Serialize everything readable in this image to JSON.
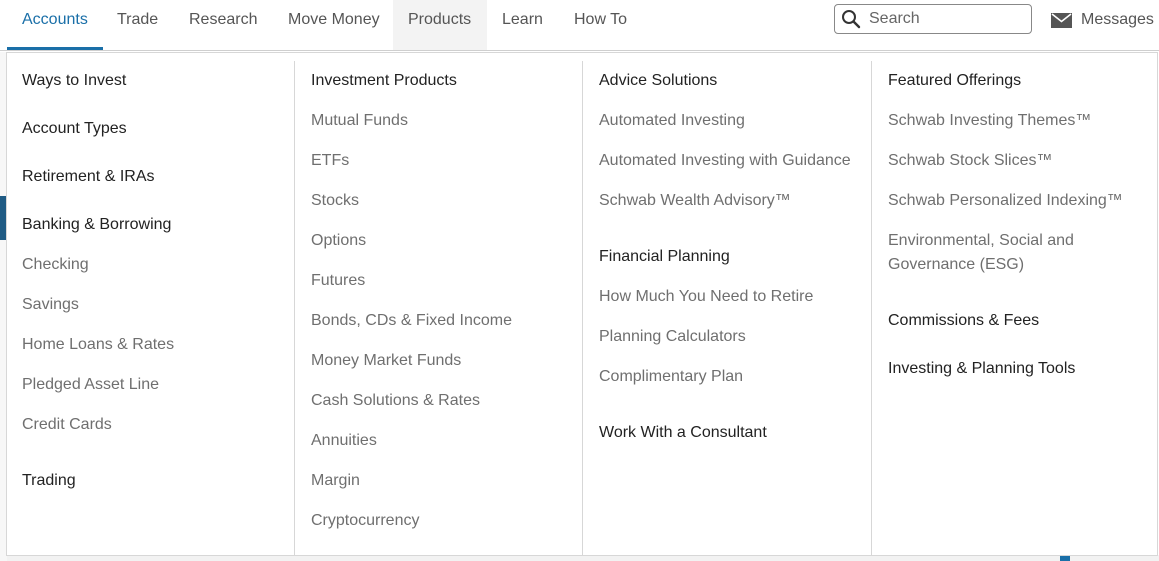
{
  "topnav": {
    "items": [
      "Accounts",
      "Trade",
      "Research",
      "Move Money",
      "Products",
      "Learn",
      "How To"
    ],
    "active": "Accounts",
    "hovered": "Products",
    "search_placeholder": "Search",
    "messages_label": "Messages"
  },
  "menu": {
    "col1": {
      "ways": "Ways to Invest",
      "account_types": "Account Types",
      "retirement": "Retirement & IRAs",
      "banking": "Banking & Borrowing",
      "checking": "Checking",
      "savings": "Savings",
      "home_loans": "Home Loans & Rates",
      "pledged": "Pledged Asset Line",
      "credit_cards": "Credit Cards",
      "trading": "Trading"
    },
    "col2": {
      "head": "Investment Products",
      "items": [
        "Mutual Funds",
        "ETFs",
        "Stocks",
        "Options",
        "Futures",
        "Bonds, CDs & Fixed Income",
        "Money Market Funds",
        "Cash Solutions & Rates",
        "Annuities",
        "Margin",
        "Cryptocurrency"
      ]
    },
    "col3": {
      "advice": "Advice Solutions",
      "automated": "Automated Investing",
      "automated_guidance": "Automated Investing with Guidance",
      "wealth": "Schwab Wealth Advisory™",
      "planning": "Financial Planning",
      "how_much": "How Much You Need to Retire",
      "calculators": "Planning Calculators",
      "complimentary": "Complimentary Plan",
      "consultant": "Work With a Consultant"
    },
    "col4": {
      "featured": "Featured Offerings",
      "themes": "Schwab Investing Themes™",
      "slices": "Schwab Stock Slices™",
      "indexing": "Schwab Personalized Indexing™",
      "esg": "Environmental, Social and Governance (ESG)",
      "commissions": "Commissions & Fees",
      "tools": "Investing & Planning Tools"
    }
  }
}
